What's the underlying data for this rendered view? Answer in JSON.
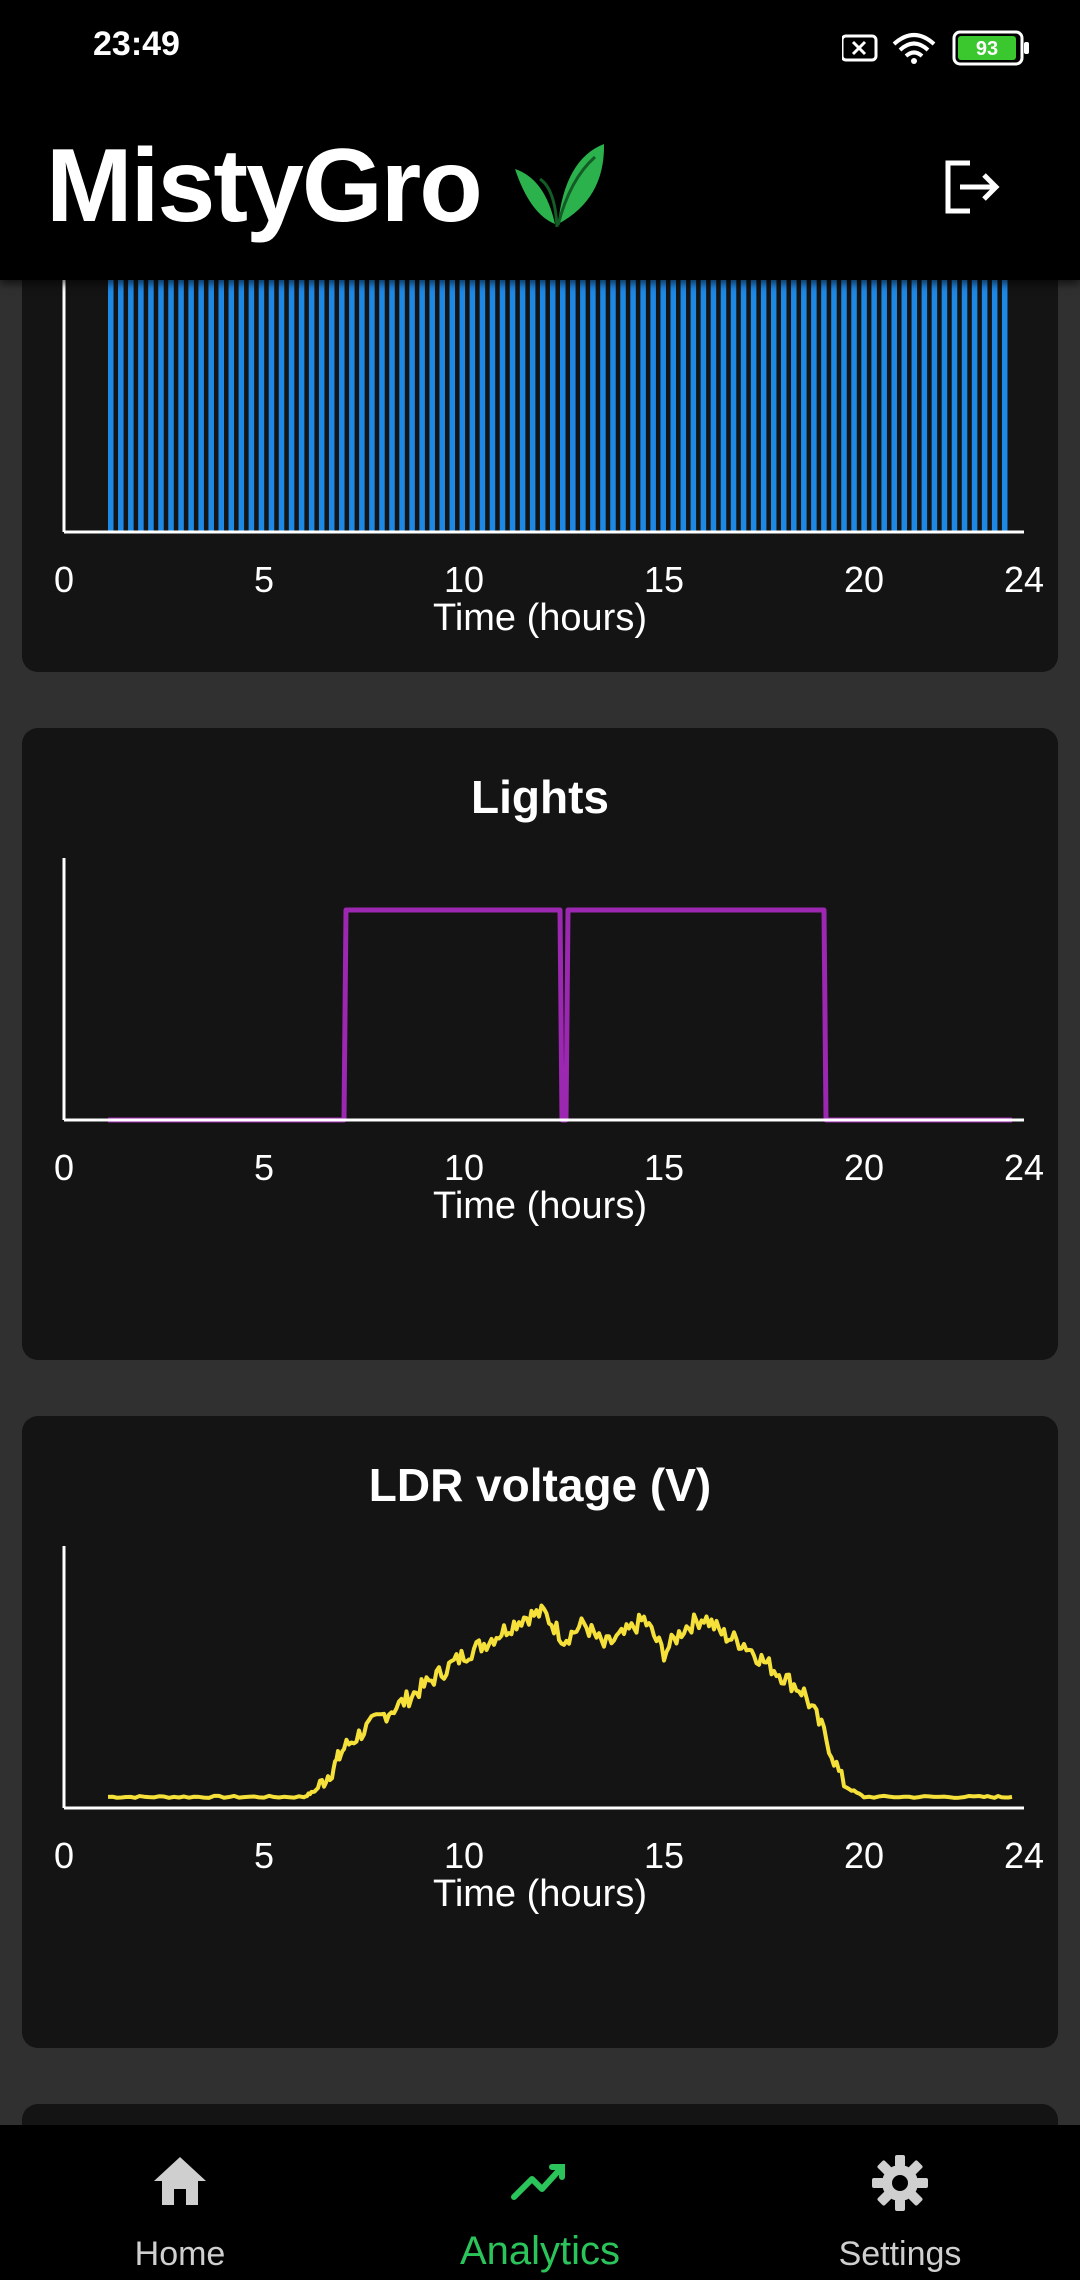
{
  "status": {
    "time": "23:49",
    "battery": "93"
  },
  "app": {
    "title": "MistyGro"
  },
  "charts": [
    {
      "id": "pump",
      "title": "",
      "color": "#1e88e5",
      "xlabel": "Time (hours)",
      "xticks": [
        "0",
        "5",
        "10",
        "15",
        "20",
        "24"
      ]
    },
    {
      "id": "lights",
      "title": "Lights",
      "color": "#9c27b0",
      "xlabel": "Time (hours)",
      "xticks": [
        "0",
        "5",
        "10",
        "15",
        "20",
        "24"
      ]
    },
    {
      "id": "ldr",
      "title": "LDR voltage (V)",
      "color": "#f5e13a",
      "xlabel": "Time (hours)",
      "xticks": [
        "0",
        "5",
        "10",
        "15",
        "20",
        "24"
      ]
    }
  ],
  "chart_data": [
    {
      "type": "bar",
      "title": "",
      "xlabel": "Time (hours)",
      "xlim": [
        0,
        24
      ],
      "note_values": "high-frequency on/off cycling between ~1.1h and ~23.7h, 90 pulses",
      "pulse_start": 1.1,
      "pulse_end": 23.7,
      "pulse_count": 90,
      "values_on": 1,
      "values_off": 0,
      "grid": false
    },
    {
      "type": "line",
      "title": "Lights",
      "xlabel": "Time (hours)",
      "xlim": [
        0,
        24
      ],
      "ylim": [
        0,
        1
      ],
      "x": [
        1.1,
        7.0,
        7.05,
        12.4,
        12.45,
        12.55,
        12.6,
        19.0,
        19.05,
        23.7
      ],
      "y": [
        0,
        0,
        1,
        1,
        0,
        0,
        1,
        1,
        0,
        0
      ],
      "grid": false
    },
    {
      "type": "line",
      "title": "LDR voltage (V)",
      "xlabel": "Time (hours)",
      "xlim": [
        0,
        24
      ],
      "ylim": [
        0,
        1
      ],
      "x": [
        1.1,
        2,
        3,
        4,
        5,
        6,
        6.3,
        6.7,
        7.0,
        7.5,
        8.0,
        8.5,
        9.0,
        9.5,
        10.0,
        10.5,
        11.0,
        11.5,
        12.0,
        12.5,
        13.0,
        13.5,
        14.0,
        14.5,
        15.0,
        15.5,
        16.0,
        16.5,
        17.0,
        17.5,
        18.0,
        18.5,
        19.0,
        19.5,
        20.0,
        21,
        22,
        23,
        23.7
      ],
      "y": [
        0.05,
        0.05,
        0.05,
        0.05,
        0.05,
        0.05,
        0.08,
        0.17,
        0.27,
        0.35,
        0.42,
        0.48,
        0.55,
        0.62,
        0.69,
        0.74,
        0.8,
        0.86,
        0.88,
        0.76,
        0.83,
        0.73,
        0.78,
        0.85,
        0.7,
        0.81,
        0.86,
        0.78,
        0.74,
        0.66,
        0.59,
        0.52,
        0.34,
        0.1,
        0.05,
        0.05,
        0.05,
        0.05,
        0.05
      ],
      "grid": false
    }
  ],
  "nav": {
    "items": [
      {
        "label": "Home",
        "icon": "home-icon"
      },
      {
        "label": "Analytics",
        "icon": "analytics-icon"
      },
      {
        "label": "Settings",
        "icon": "settings-icon"
      }
    ]
  }
}
